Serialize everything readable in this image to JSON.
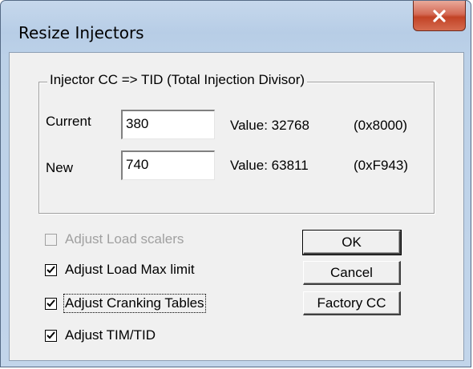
{
  "window": {
    "title": "Resize Injectors",
    "close_icon": "close-icon",
    "accent_close": "#c24326"
  },
  "group": {
    "label": "Injector CC => TID (Total Injection Divisor)",
    "rows": [
      {
        "label": "Current",
        "value": "380",
        "value_text": "Value: 32768",
        "hex_text": "(0x8000)"
      },
      {
        "label": "New",
        "value": "740",
        "value_text": "Value: 63811",
        "hex_text": "(0xF943)"
      }
    ]
  },
  "options": [
    {
      "label": "Adjust Load scalers",
      "checked": false,
      "disabled": true
    },
    {
      "label": "Adjust Load Max limit",
      "checked": true,
      "disabled": false
    },
    {
      "label": "Adjust Cranking Tables",
      "checked": true,
      "disabled": false,
      "focused": true
    },
    {
      "label": "Adjust TIM/TID",
      "checked": true,
      "disabled": false
    }
  ],
  "buttons": {
    "ok": "OK",
    "cancel": "Cancel",
    "factory": "Factory CC"
  }
}
